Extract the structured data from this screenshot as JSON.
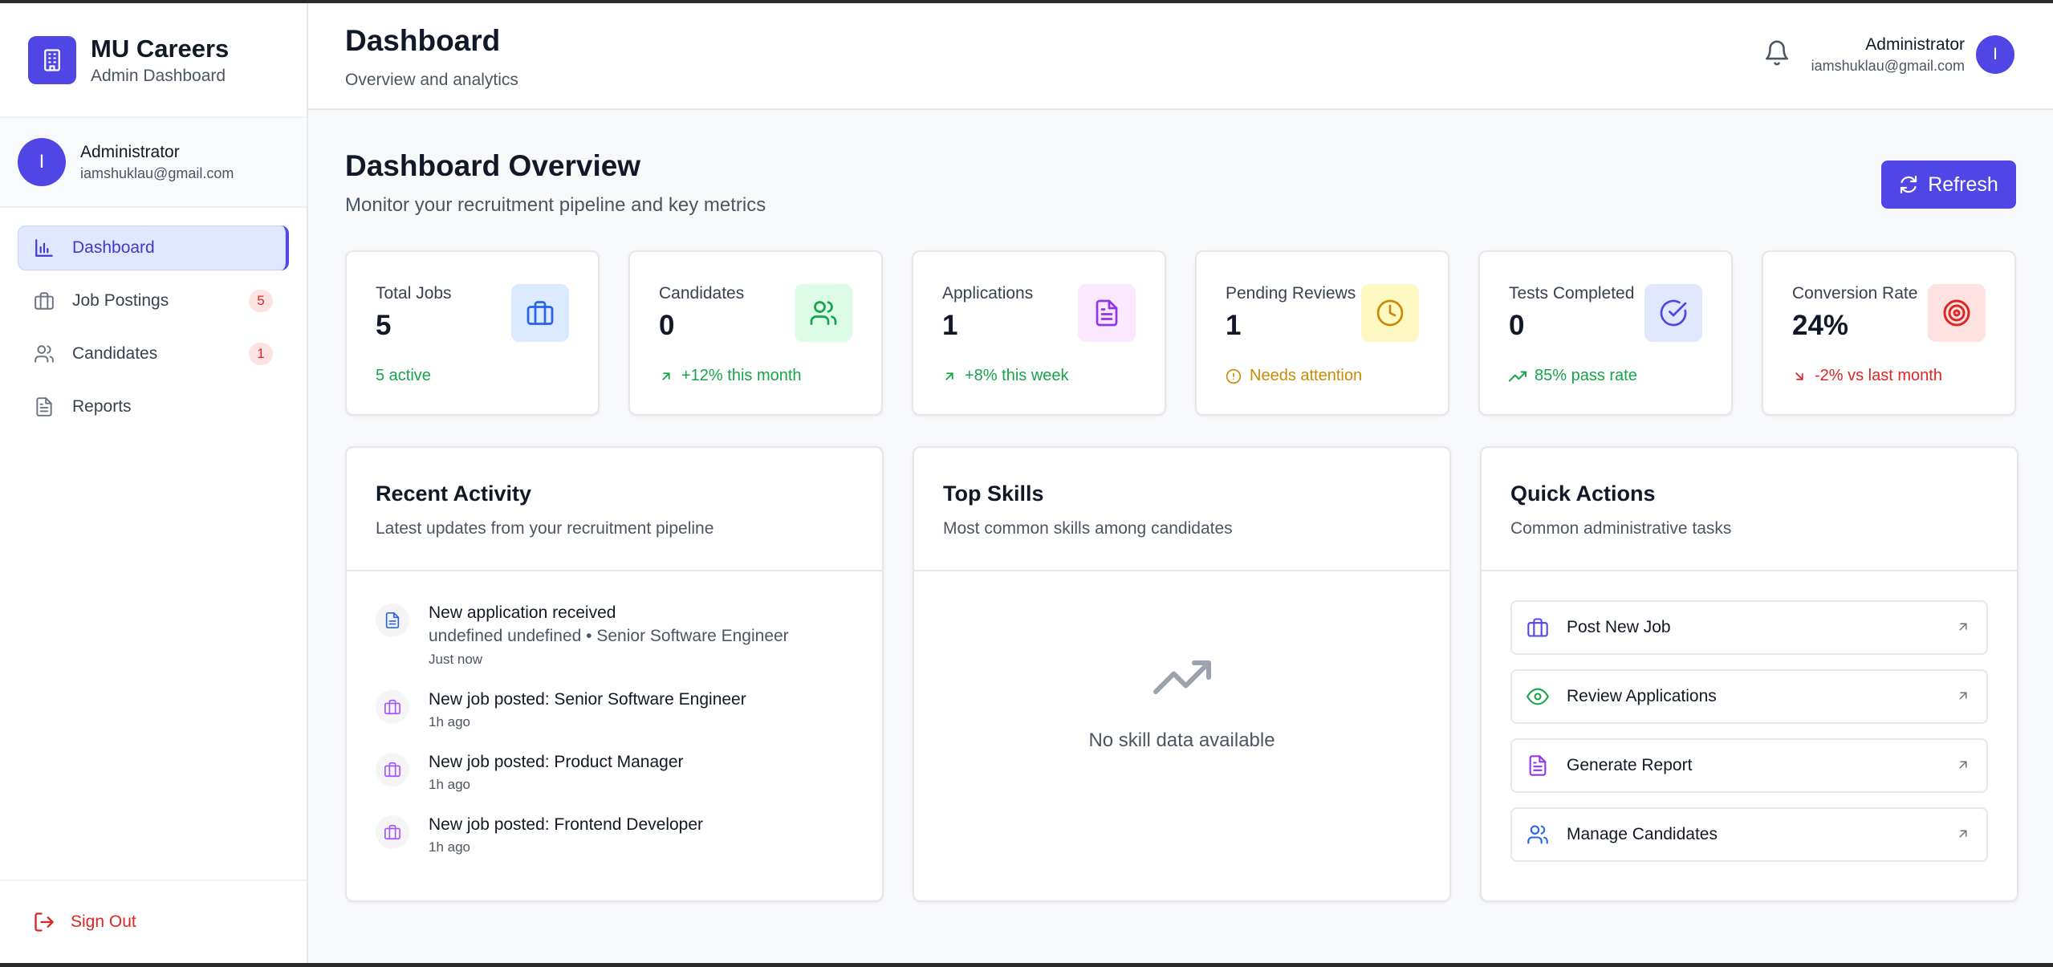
{
  "brand": {
    "title": "MU Careers",
    "subtitle": "Admin Dashboard"
  },
  "sidebar_user": {
    "initial": "I",
    "name": "Administrator",
    "email": "iamshuklau@gmail.com"
  },
  "nav": [
    {
      "label": "Dashboard",
      "icon": "bar-chart-icon",
      "active": true
    },
    {
      "label": "Job Postings",
      "icon": "briefcase-icon",
      "badge": "5"
    },
    {
      "label": "Candidates",
      "icon": "users-icon",
      "badge": "1"
    },
    {
      "label": "Reports",
      "icon": "file-icon"
    }
  ],
  "signout_label": "Sign Out",
  "header": {
    "title": "Dashboard",
    "subtitle": "Overview and analytics",
    "user_name": "Administrator",
    "user_email": "iamshuklau@gmail.com",
    "user_initial": "I"
  },
  "overview": {
    "title": "Dashboard Overview",
    "subtitle": "Monitor your recruitment pipeline and key metrics",
    "refresh_label": "Refresh"
  },
  "stats": [
    {
      "label": "Total Jobs",
      "value": "5",
      "foot": "5 active",
      "foot_color": "#16a34a",
      "icon": "briefcase-icon",
      "icon_bg": "#dbeafe",
      "icon_color": "#2563eb"
    },
    {
      "label": "Candidates",
      "value": "0",
      "foot": "+12% this month",
      "foot_color": "#16a34a",
      "icon": "users-icon",
      "icon_bg": "#dcfce7",
      "icon_color": "#16a34a"
    },
    {
      "label": "Applications",
      "value": "1",
      "foot": "+8% this week",
      "foot_color": "#16a34a",
      "icon": "file-text-icon",
      "icon_bg": "#fae8ff",
      "icon_color": "#9333ea"
    },
    {
      "label": "Pending Reviews",
      "value": "1",
      "foot": "Needs attention",
      "foot_color": "#ca8a04",
      "icon": "clock-icon",
      "icon_bg": "#fef9c3",
      "icon_color": "#ca8a04"
    },
    {
      "label": "Tests Completed",
      "value": "0",
      "foot": "85% pass rate",
      "foot_color": "#16a34a",
      "icon": "check-circle-icon",
      "icon_bg": "#e0e7ff",
      "icon_color": "#4f46e5"
    },
    {
      "label": "Conversion Rate",
      "value": "24%",
      "foot": "-2% vs last month",
      "foot_color": "#dc2626",
      "icon": "target-icon",
      "icon_bg": "#fee2e2",
      "icon_color": "#dc2626"
    }
  ],
  "recent_activity": {
    "title": "Recent Activity",
    "subtitle": "Latest updates from your recruitment pipeline",
    "items": [
      {
        "title": "New application received",
        "detail": "undefined undefined • Senior Software Engineer",
        "time": "Just now",
        "icon": "file-text-icon"
      },
      {
        "title": "New job posted: Senior Software Engineer",
        "time": "1h ago",
        "icon": "briefcase-icon"
      },
      {
        "title": "New job posted: Product Manager",
        "time": "1h ago",
        "icon": "briefcase-icon"
      },
      {
        "title": "New job posted: Frontend Developer",
        "time": "1h ago",
        "icon": "briefcase-icon"
      }
    ]
  },
  "top_skills": {
    "title": "Top Skills",
    "subtitle": "Most common skills among candidates",
    "empty_text": "No skill data available"
  },
  "quick_actions": {
    "title": "Quick Actions",
    "subtitle": "Common administrative tasks",
    "items": [
      {
        "label": "Post New Job",
        "icon": "briefcase-icon",
        "color": "#4f46e5"
      },
      {
        "label": "Review Applications",
        "icon": "eye-icon",
        "color": "#16a34a"
      },
      {
        "label": "Generate Report",
        "icon": "file-text-icon",
        "color": "#9333ea"
      },
      {
        "label": "Manage Candidates",
        "icon": "users-icon",
        "color": "#2563eb"
      }
    ]
  }
}
